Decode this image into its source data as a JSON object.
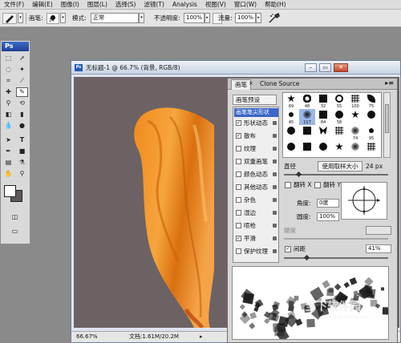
{
  "menubar": [
    "文件(F)",
    "编辑(E)",
    "图像(I)",
    "图层(L)",
    "选择(S)",
    "滤镜(T)",
    "Analysis",
    "视图(V)",
    "窗口(W)",
    "帮助(H)"
  ],
  "options": {
    "brush_label": "画笔:",
    "brush_size": "24",
    "mode_label": "模式:",
    "mode_value": "正常",
    "opacity_label": "不透明度:",
    "opacity_value": "100%",
    "flow_label": "流量:",
    "flow_value": "100%"
  },
  "tools": {
    "ps_logo": "Ps"
  },
  "document": {
    "title": "无标题-1 @ 66.7% (背景, RGB/8)",
    "zoom": "66.67%",
    "doc_info": "文档:1.61M/20.2M"
  },
  "panel": {
    "tabs": [
      "画笔",
      "Clone Source"
    ],
    "presets_btn": "画笔预设",
    "selected_option": "画笔笔尖形状",
    "options": [
      {
        "label": "形状动态",
        "checked": true
      },
      {
        "label": "散布",
        "checked": true
      },
      {
        "label": "纹理",
        "checked": false
      },
      {
        "label": "双重画笔",
        "checked": false
      },
      {
        "label": "颜色动态",
        "checked": false
      },
      {
        "label": "其他动态",
        "checked": false
      },
      {
        "label": "杂色",
        "checked": false
      },
      {
        "label": "湿边",
        "checked": false
      },
      {
        "label": "喷枪",
        "checked": false
      },
      {
        "label": "平滑",
        "checked": true
      },
      {
        "label": "保护纹理",
        "checked": false
      }
    ],
    "brush_numbers": [
      "69",
      "48",
      "32",
      "55",
      "100",
      "75",
      "45",
      "117",
      "84",
      "58",
      "",
      "",
      "",
      "",
      "",
      "",
      "74",
      "95",
      "",
      "",
      "",
      "",
      "",
      "",
      "",
      "",
      "",
      "",
      "",
      "",
      "",
      "",
      "",
      "",
      "",
      "",
      "",
      ""
    ],
    "diameter_label": "直径",
    "use_sample_btn": "使用取样大小",
    "diameter_value": "24 px",
    "flip_x": "翻转 X",
    "flip_y": "翻转 Y",
    "angle_label": "角度:",
    "angle_value": "0度",
    "roundness_label": "圆度:",
    "roundness_value": "100%",
    "hardness_label": "硬度",
    "spacing_label": "间距",
    "spacing_checked": true,
    "spacing_value": "41%"
  },
  "watermark": {
    "brand": "当下软件园",
    "url": "www.downxia.com"
  }
}
